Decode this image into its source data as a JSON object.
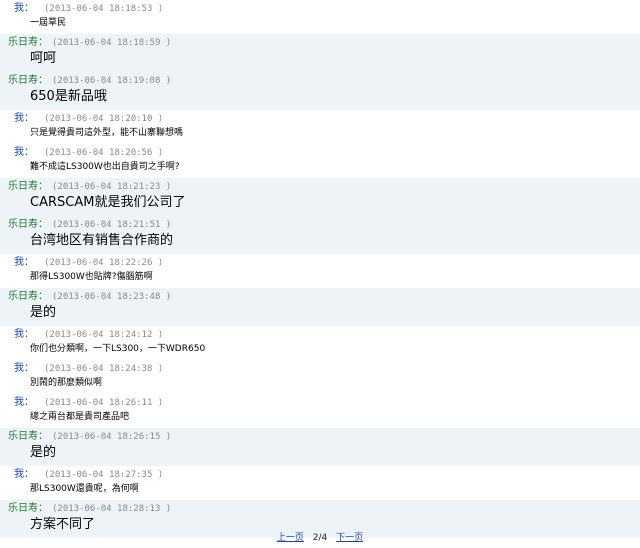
{
  "messages": [
    {
      "sender": "我：",
      "who": "me",
      "time": "(2013-06-04 18:18:53 )",
      "text": "一屆草民",
      "size": "small"
    },
    {
      "sender": "乐日寿：",
      "who": "other",
      "time": "(2013-06-04 18:18:59 )",
      "text": "呵呵",
      "size": "big"
    },
    {
      "sender": "乐日寿：",
      "who": "other",
      "time": "(2013-06-04 18:19:08 )",
      "text": "650是新品哦",
      "size": "big"
    },
    {
      "sender": "我：",
      "who": "me",
      "time": "(2013-06-04 18:20:10 )",
      "text": "只是覺得貴司這外型，能不山寨聯想嗎",
      "size": "small"
    },
    {
      "sender": "我：",
      "who": "me",
      "time": "(2013-06-04 18:20:56 )",
      "text": "難不成這LS300W也出自貴司之手啊?",
      "size": "small"
    },
    {
      "sender": "乐日寿：",
      "who": "other",
      "time": "(2013-06-04 18:21:23 )",
      "text": "CARSCAM就是我们公司了",
      "size": "big"
    },
    {
      "sender": "乐日寿：",
      "who": "other",
      "time": "(2013-06-04 18:21:51 )",
      "text": "台湾地区有销售合作商的",
      "size": "big"
    },
    {
      "sender": "我：",
      "who": "me",
      "time": "(2013-06-04 18:22:26 )",
      "text": "那得LS300W也貼牌?傷腦筋啊",
      "size": "small"
    },
    {
      "sender": "乐日寿：",
      "who": "other",
      "time": "(2013-06-04 18:23:48 )",
      "text": "是的",
      "size": "big"
    },
    {
      "sender": "我：",
      "who": "me",
      "time": "(2013-06-04 18:24:12 )",
      "text": "你们也分類啊，一下LS300，一下WDR650",
      "size": "small"
    },
    {
      "sender": "我：",
      "who": "me",
      "time": "(2013-06-04 18:24:38 )",
      "text": "別鬧的那麼類似啊",
      "size": "small"
    },
    {
      "sender": "我：",
      "who": "me",
      "time": "(2013-06-04 18:26:11 )",
      "text": "總之兩台都是貴司產品吧",
      "size": "small"
    },
    {
      "sender": "乐日寿：",
      "who": "other",
      "time": "(2013-06-04 18:26:15 )",
      "text": "是的",
      "size": "big"
    },
    {
      "sender": "我：",
      "who": "me",
      "time": "(2013-06-04 18:27:35 )",
      "text": "那LS300W還貴呢，為何啊",
      "size": "small"
    },
    {
      "sender": "乐日寿：",
      "who": "other",
      "time": "(2013-06-04 18:28:13 )",
      "text": "方案不同了",
      "size": "big"
    }
  ],
  "pager": {
    "prev": "上一页",
    "position": "2/4",
    "next": "下一页"
  }
}
